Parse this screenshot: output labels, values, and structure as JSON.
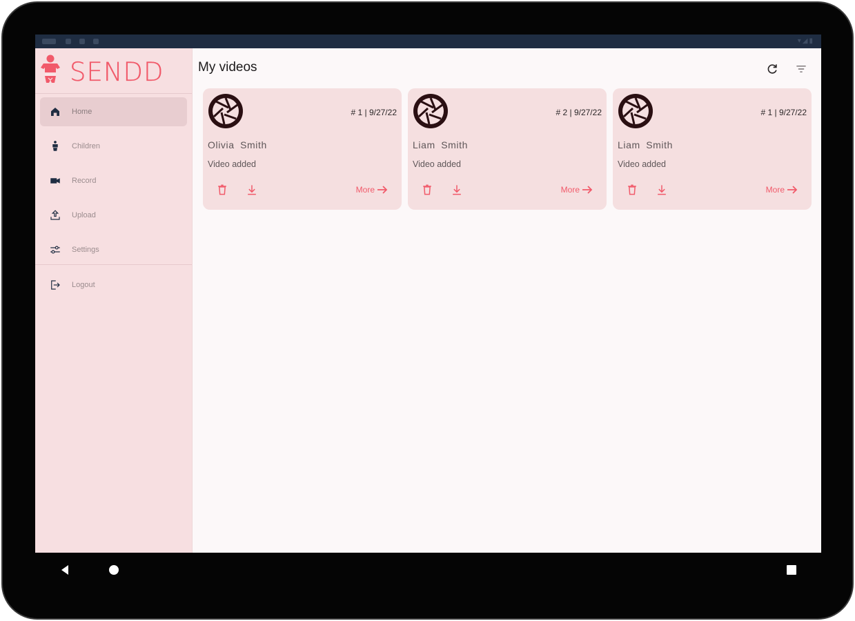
{
  "app": {
    "brand": "SENDD",
    "accent": "#f15a6a",
    "sidebar_bg": "#f7dfe1"
  },
  "sidebar": {
    "items": [
      {
        "label": "Home",
        "icon": "home-icon",
        "active": true
      },
      {
        "label": "Children",
        "icon": "children-icon"
      },
      {
        "label": "Record",
        "icon": "video-camera-icon"
      },
      {
        "label": "Upload",
        "icon": "upload-icon"
      },
      {
        "label": "Settings",
        "icon": "settings-sliders-icon"
      },
      {
        "label": "Logout",
        "icon": "logout-icon"
      }
    ]
  },
  "main": {
    "title": "My videos",
    "toolbar": {
      "refresh_icon": "refresh-icon",
      "filter_icon": "filter-icon"
    }
  },
  "cards": [
    {
      "meta": "# 1 | 9/27/22",
      "name": "Olivia  Smith",
      "status": "Video added",
      "more": "More"
    },
    {
      "meta": "# 2 | 9/27/22",
      "name": "Liam  Smith",
      "status": "Video added",
      "more": "More"
    },
    {
      "meta": "# 1 | 9/27/22",
      "name": "Liam  Smith",
      "status": "Video added",
      "more": "More"
    }
  ],
  "system_nav": {
    "back_icon": "back-triangle-icon",
    "home_icon": "home-circle-icon",
    "recents_icon": "recents-square-icon"
  }
}
